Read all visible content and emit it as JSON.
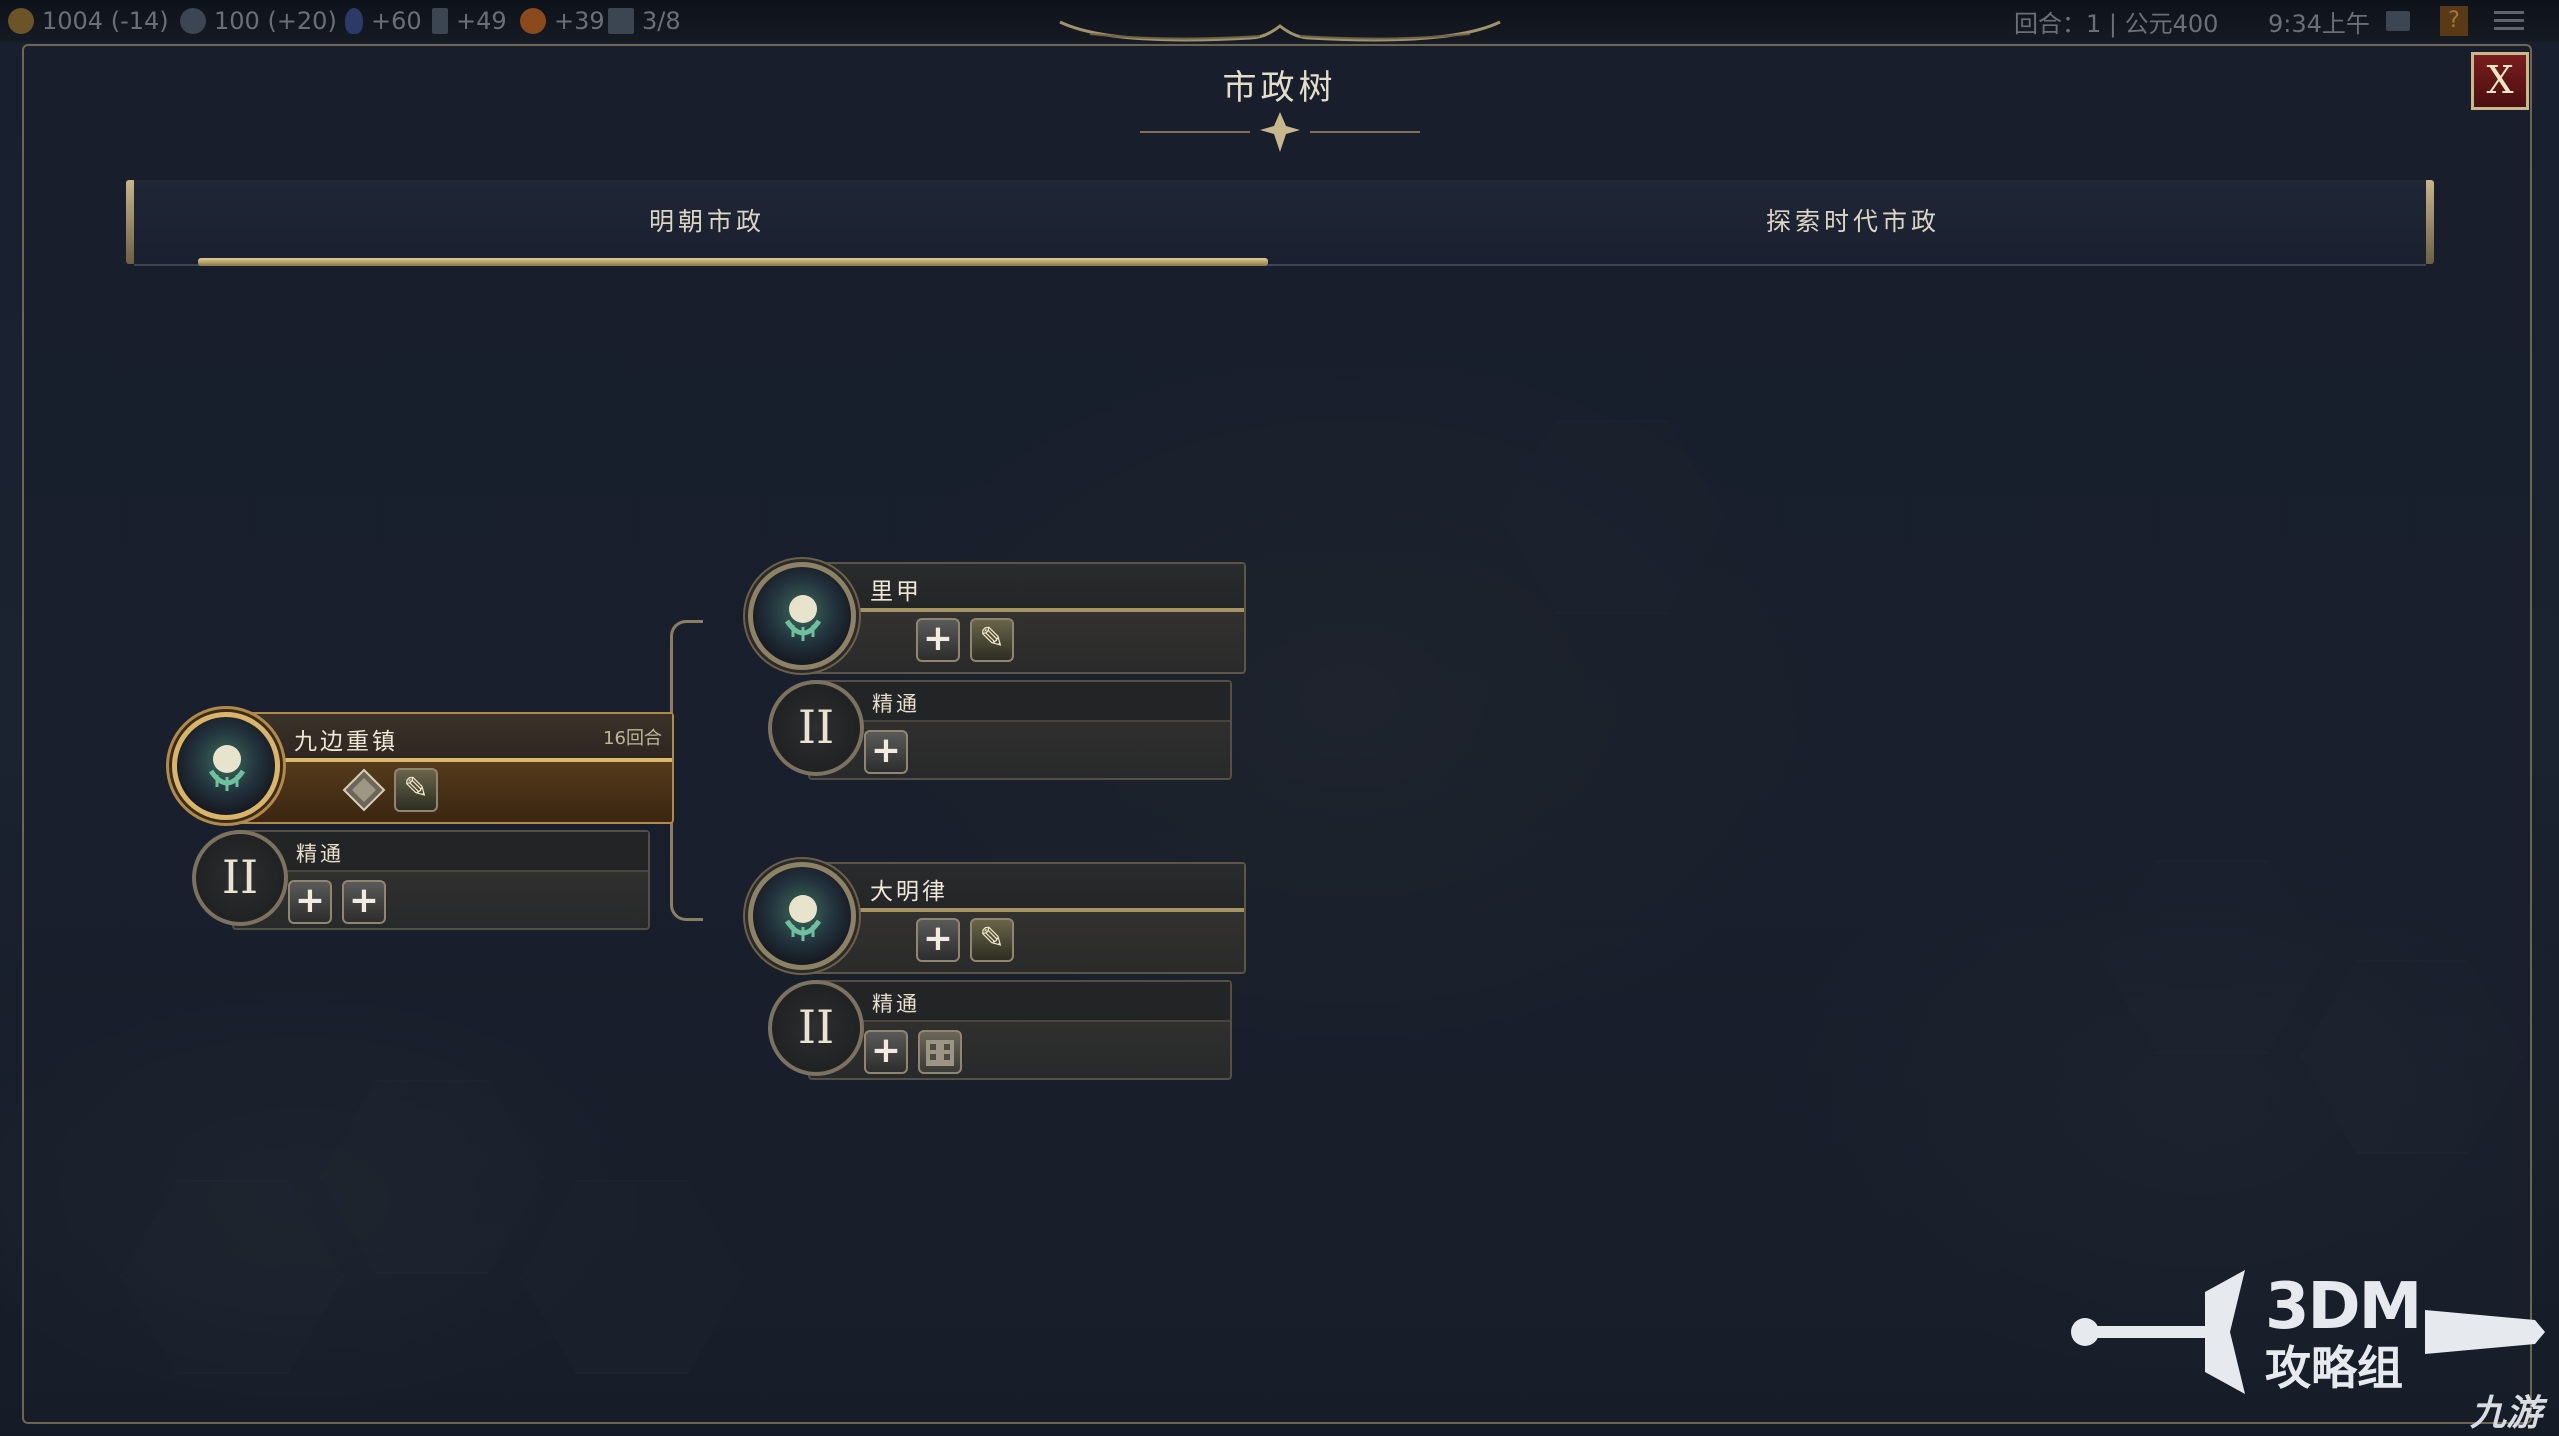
{
  "topbar": {
    "gold": "1004 (-14)",
    "science": "100 (+20)",
    "faith": "+60",
    "culture": "+49",
    "happiness": "+39",
    "cities": "3/8",
    "turn": "回合：1 | 公元400",
    "clock": "9:34上午"
  },
  "panel": {
    "title": "市政树",
    "close_label": "X"
  },
  "tabs": [
    {
      "label": "明朝市政",
      "selected": true
    },
    {
      "label": "探索时代市政",
      "selected": false
    }
  ],
  "tree": {
    "nodes": [
      {
        "name": "九边重镇",
        "turns": "16回合",
        "state": "researching",
        "unlocks": [
          "diamond-icon",
          "feather-icon"
        ]
      },
      {
        "name": "里甲",
        "state": "available",
        "unlocks": [
          "plus-icon",
          "feather-icon"
        ]
      },
      {
        "name": "大明律",
        "state": "available",
        "unlocks": [
          "plus-icon",
          "feather-icon"
        ]
      }
    ],
    "masteries": [
      {
        "numeral": "II",
        "name": "精通",
        "unlocks": [
          "plus-icon",
          "plus-icon"
        ]
      },
      {
        "numeral": "II",
        "name": "精通",
        "unlocks": [
          "plus-icon"
        ]
      },
      {
        "numeral": "II",
        "name": "精通",
        "unlocks": [
          "plus-icon",
          "building-icon"
        ]
      }
    ]
  },
  "watermark": {
    "brand": "3DM",
    "sub": "攻略组",
    "site": "九游"
  },
  "colors": {
    "accent_gold": "#d9b46a",
    "panel_border": "#6f6650",
    "close_red": "#7a1d1d"
  }
}
